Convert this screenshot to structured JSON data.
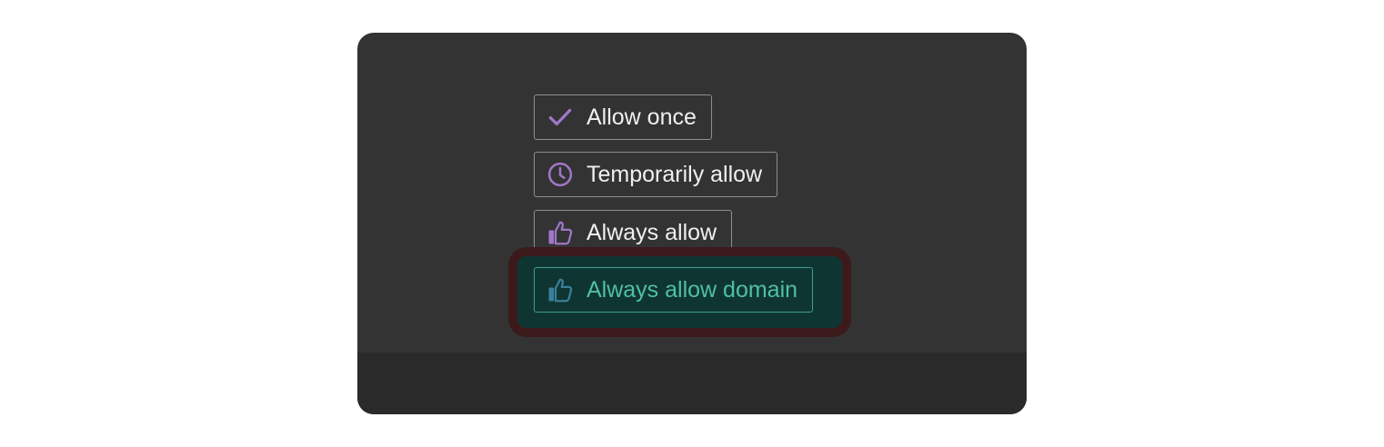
{
  "buttons": [
    {
      "label": "Allow once",
      "icon": "check-icon"
    },
    {
      "label": "Temporarily allow",
      "icon": "clock-icon"
    },
    {
      "label": "Always allow",
      "icon": "thumbs-up-icon"
    },
    {
      "label": "Always allow domain",
      "icon": "thumbs-up-icon"
    }
  ],
  "colors": {
    "panel_bg": "#333333",
    "footer_bg": "#2a2a2a",
    "icon_purple": "#a077c9",
    "highlight_text": "#4fc0a0",
    "highlight_bg": "#0f3532",
    "highlight_ring": "#3c1a1c"
  }
}
